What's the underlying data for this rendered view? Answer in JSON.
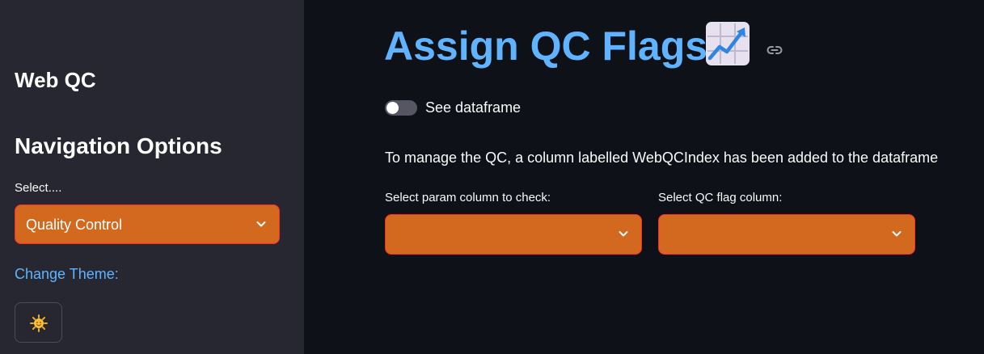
{
  "sidebar": {
    "title": "Web QC",
    "nav_heading": "Navigation Options",
    "select_label": "Select....",
    "select_value": "Quality Control",
    "change_theme_label": "Change Theme:",
    "theme_icon": "sun-emoji-icon"
  },
  "main": {
    "title": "Assign QC Flags",
    "title_icon": "chart-increasing-emoji-icon",
    "toggle": {
      "label": "See dataframe",
      "checked": false
    },
    "info": "To manage the QC, a column labelled WebQCIndex has been added to the dataframe",
    "param_select": {
      "label": "Select param column to check:",
      "value": ""
    },
    "flag_select": {
      "label": "Select QC flag column:",
      "value": ""
    }
  },
  "colors": {
    "sidebar_bg": "#262730",
    "main_bg": "#0e1117",
    "title_blue": "#60b4ff",
    "select_bg": "#d2691e",
    "select_border": "#ff2b2b"
  }
}
